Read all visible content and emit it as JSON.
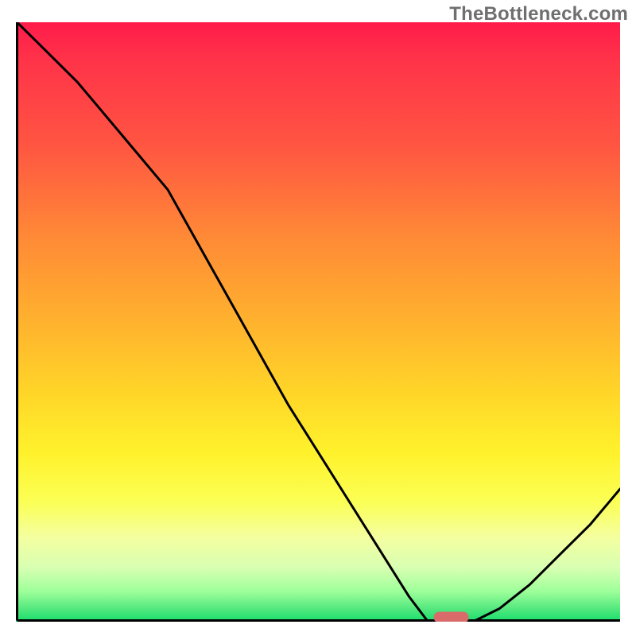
{
  "watermark_text": "TheBottleneck.com",
  "chart_data": {
    "type": "line",
    "title": "",
    "xlabel": "",
    "ylabel": "",
    "x": [
      0.0,
      0.05,
      0.1,
      0.15,
      0.2,
      0.25,
      0.3,
      0.35,
      0.4,
      0.45,
      0.5,
      0.55,
      0.6,
      0.65,
      0.68,
      0.72,
      0.76,
      0.8,
      0.85,
      0.9,
      0.95,
      1.0
    ],
    "values": [
      1.0,
      0.95,
      0.9,
      0.84,
      0.78,
      0.72,
      0.63,
      0.54,
      0.45,
      0.36,
      0.28,
      0.2,
      0.12,
      0.04,
      0.0,
      0.0,
      0.0,
      0.02,
      0.06,
      0.11,
      0.16,
      0.22
    ],
    "xlim": [
      0,
      1
    ],
    "ylim": [
      0,
      1
    ],
    "marker": {
      "x": 0.72,
      "y": 0.0
    },
    "background_gradient": {
      "type": "vertical",
      "stops": [
        {
          "pos": 0.0,
          "color": "#ff1b4a"
        },
        {
          "pos": 0.5,
          "color": "#ffb22e"
        },
        {
          "pos": 0.8,
          "color": "#fbff55"
        },
        {
          "pos": 1.0,
          "color": "#18de6e"
        }
      ]
    }
  }
}
